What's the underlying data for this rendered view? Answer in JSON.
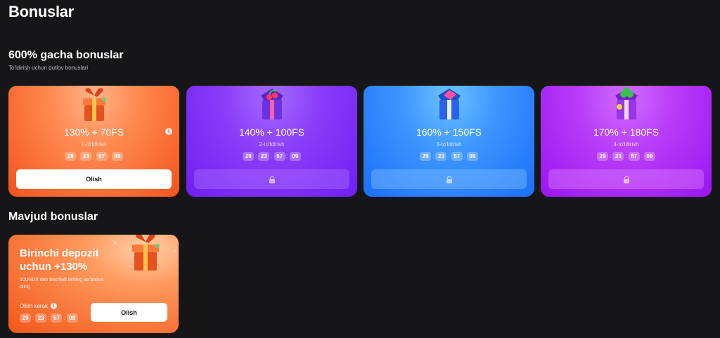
{
  "page": {
    "title": "Bonuslar"
  },
  "deposit_section": {
    "title": "600% gacha bonuslar",
    "subtitle": "To'ldirish uchun qutlov bonuslari",
    "cards": [
      {
        "amount": "130% + 70FS",
        "step": "1-to'ldirish",
        "timer": [
          "29",
          "23",
          "57",
          "09"
        ],
        "button": "Olish",
        "locked": false,
        "info_icon": "i",
        "accent": "#f2541a"
      },
      {
        "amount": "140% + 100FS",
        "step": "2-to'ldirish",
        "timer": [
          "29",
          "23",
          "57",
          "09"
        ],
        "locked": true,
        "accent": "#6f1ff0"
      },
      {
        "amount": "160% + 150FS",
        "step": "3-to'ldirish",
        "timer": [
          "29",
          "23",
          "57",
          "09"
        ],
        "locked": true,
        "accent": "#1a6ff7"
      },
      {
        "amount": "170% + 180FS",
        "step": "4-to'ldirish",
        "timer": [
          "29",
          "23",
          "57",
          "09"
        ],
        "locked": true,
        "accent": "#9a15f0"
      }
    ]
  },
  "available_section": {
    "title": "Mavjud bonuslar",
    "card": {
      "title": "Birinchi depozit uchun +130%",
      "description": "10USD₮ dan boshlab kiriting va bonus oling",
      "needed_label": "Olish kerak",
      "info_icon": "i",
      "timer": [
        "29",
        "23",
        "57",
        "08"
      ],
      "button": "Olish"
    }
  },
  "icons": {
    "gift": "gift-box-icon",
    "lock": "lock-icon",
    "info": "info-icon"
  }
}
